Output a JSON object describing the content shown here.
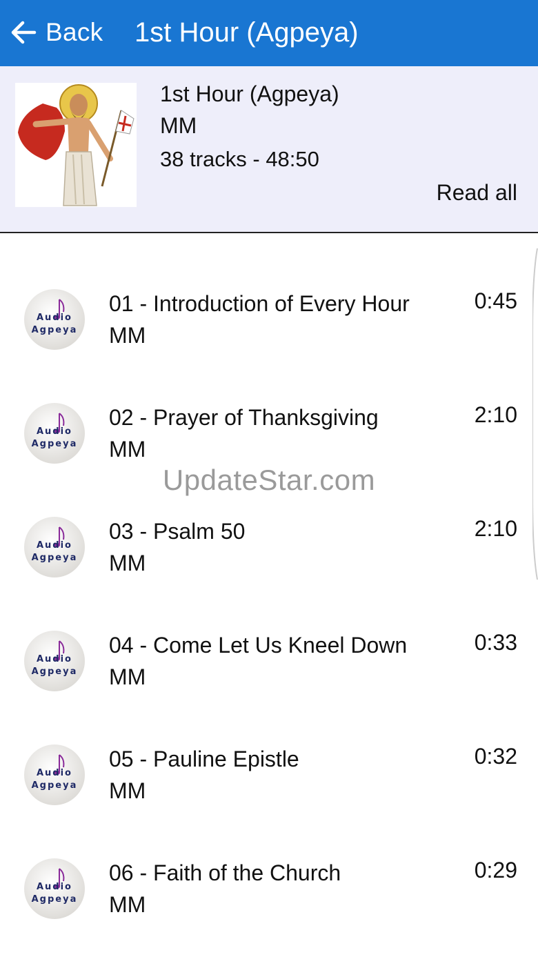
{
  "appbar": {
    "back_label": "Back",
    "title": "1st Hour (Agpeya)",
    "color": "#1976d2"
  },
  "album": {
    "title": "1st Hour (Agpeya)",
    "artist": "MM",
    "meta": "38 tracks - 48:50",
    "read_all_label": "Read all",
    "background": "#eeeefa"
  },
  "tracks": [
    {
      "title": "01 - Introduction of Every Hour",
      "artist": "MM",
      "duration": "0:45"
    },
    {
      "title": "02 - Prayer of Thanksgiving",
      "artist": "MM",
      "duration": "2:10"
    },
    {
      "title": "03 - Psalm 50",
      "artist": "MM",
      "duration": "2:10"
    },
    {
      "title": "04 - Come Let Us Kneel Down",
      "artist": "MM",
      "duration": "0:33"
    },
    {
      "title": "05 - Pauline Epistle",
      "artist": "MM",
      "duration": "0:32"
    },
    {
      "title": "06 - Faith of the Church",
      "artist": "MM",
      "duration": "0:29"
    }
  ],
  "track_icon": {
    "line1": "Audio",
    "line2": "Agpeya"
  },
  "watermark": "UpdateStar.com"
}
